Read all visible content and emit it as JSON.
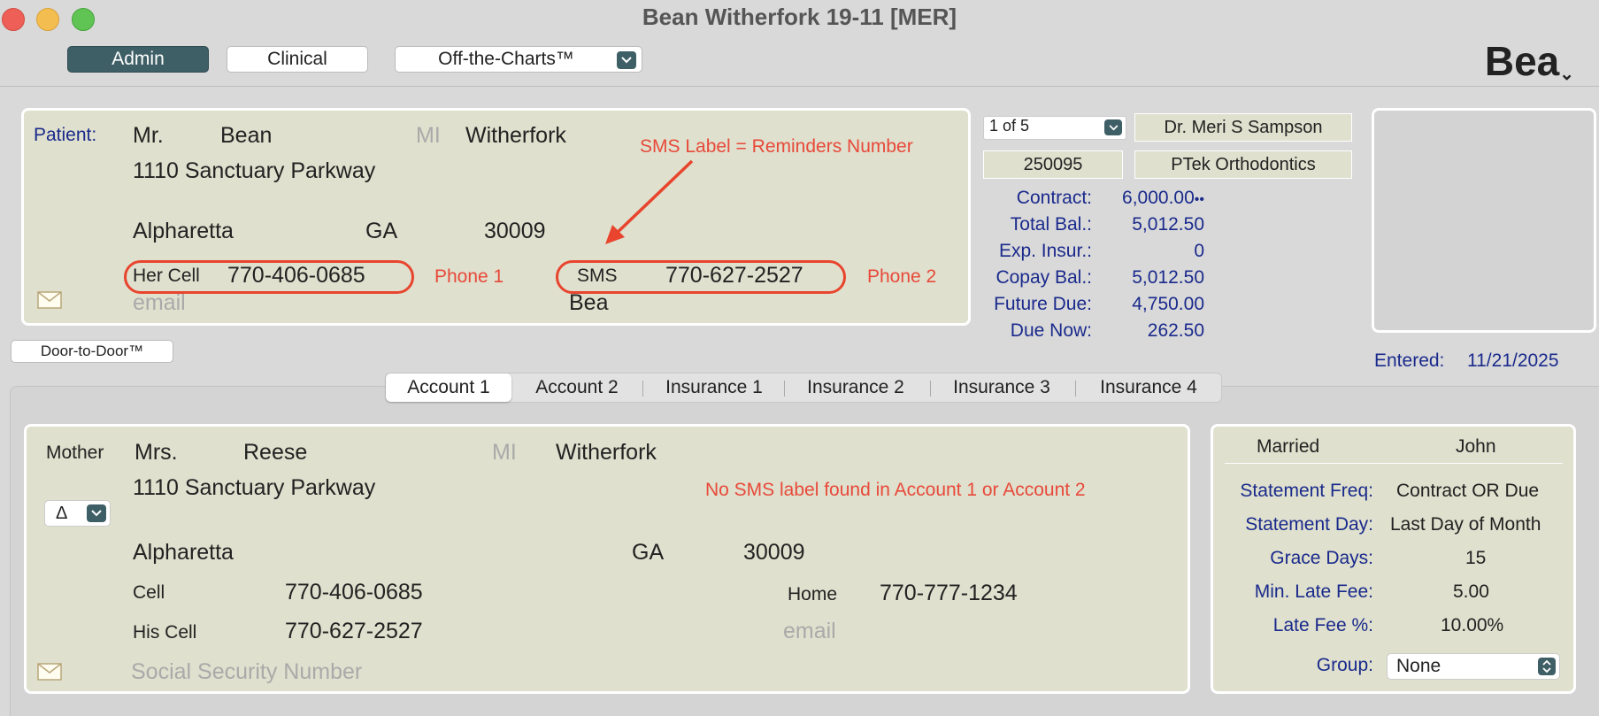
{
  "window": {
    "title": "Bean Witherfork 19-11 [MER]"
  },
  "toolbar": {
    "admin_label": "Admin",
    "clinical_label": "Clinical",
    "off_charts_label": "Off-the-Charts™",
    "user_badge": "Bea"
  },
  "patient": {
    "section_label": "Patient:",
    "prefix": "Mr.",
    "first": "Bean",
    "mi_placeholder": "MI",
    "last": "Witherfork",
    "address": "1110 Sanctuary Parkway",
    "city": "Alpharetta",
    "state": "GA",
    "zip": "30009",
    "phone1_label": "Her Cell",
    "phone1": "770-406-0685",
    "phone2_label": "SMS",
    "phone2": "770-627-2527",
    "email_placeholder": "email",
    "nickname": "Bea"
  },
  "annotations": {
    "sms_note": "SMS Label = Reminders Number",
    "phone1_note": "Phone 1",
    "phone2_note": "Phone 2",
    "account_note": "No SMS label found in Account 1 or Account 2"
  },
  "record": {
    "nav": "1 of 5",
    "doctor": "Dr. Meri S Sampson",
    "account_id": "250095",
    "practice": "PTek Orthodontics"
  },
  "balances": [
    {
      "label": "Contract:",
      "value": "6,000.00",
      "suffix": "••"
    },
    {
      "label": "Total Bal.:",
      "value": "5,012.50"
    },
    {
      "label": "Exp. Insur.:",
      "value": "0"
    },
    {
      "label": "Copay Bal.:",
      "value": "5,012.50"
    },
    {
      "label": "Future Due:",
      "value": "4,750.00"
    },
    {
      "label": "Due Now:",
      "value": "262.50"
    }
  ],
  "entered": {
    "label": "Entered:",
    "date": "11/21/2025"
  },
  "door_button": "Door-to-Door™",
  "tabs": [
    "Account 1",
    "Account 2",
    "Insurance 1",
    "Insurance 2",
    "Insurance 3",
    "Insurance 4"
  ],
  "guarantor": {
    "relation": "Mother",
    "relation_select": "Δ",
    "prefix": "Mrs.",
    "first": "Reese",
    "mi_placeholder": "MI",
    "last": "Witherfork",
    "address": "1110 Sanctuary Parkway",
    "city": "Alpharetta",
    "state": "GA",
    "zip": "30009",
    "phone1_label": "Cell",
    "phone1": "770-406-0685",
    "phone2_label": "Home",
    "phone2": "770-777-1234",
    "phone3_label": "His Cell",
    "phone3": "770-627-2527",
    "email_placeholder": "email",
    "ssn_placeholder": "Social Security Number"
  },
  "billing": {
    "marital": "Married",
    "spouse": "John",
    "rows": [
      {
        "label": "Statement Freq:",
        "value": "Contract OR Due"
      },
      {
        "label": "Statement Day:",
        "value": "Last Day of Month"
      },
      {
        "label": "Grace Days:",
        "value": "15"
      },
      {
        "label": "Min. Late Fee:",
        "value": "5.00"
      },
      {
        "label": "Late Fee %:",
        "value": "10.00%"
      }
    ],
    "group_label": "Group:",
    "group_value": "None"
  },
  "colors": {
    "accent": "#3f5f66",
    "panel": "#dfe0cd",
    "label_blue": "#1a2a8c",
    "annotation_red": "#e8493a"
  },
  "icons": {
    "dropdown": "chevron-down-icon",
    "mail": "envelope-icon",
    "stepper": "up-down-chevron-icon"
  }
}
